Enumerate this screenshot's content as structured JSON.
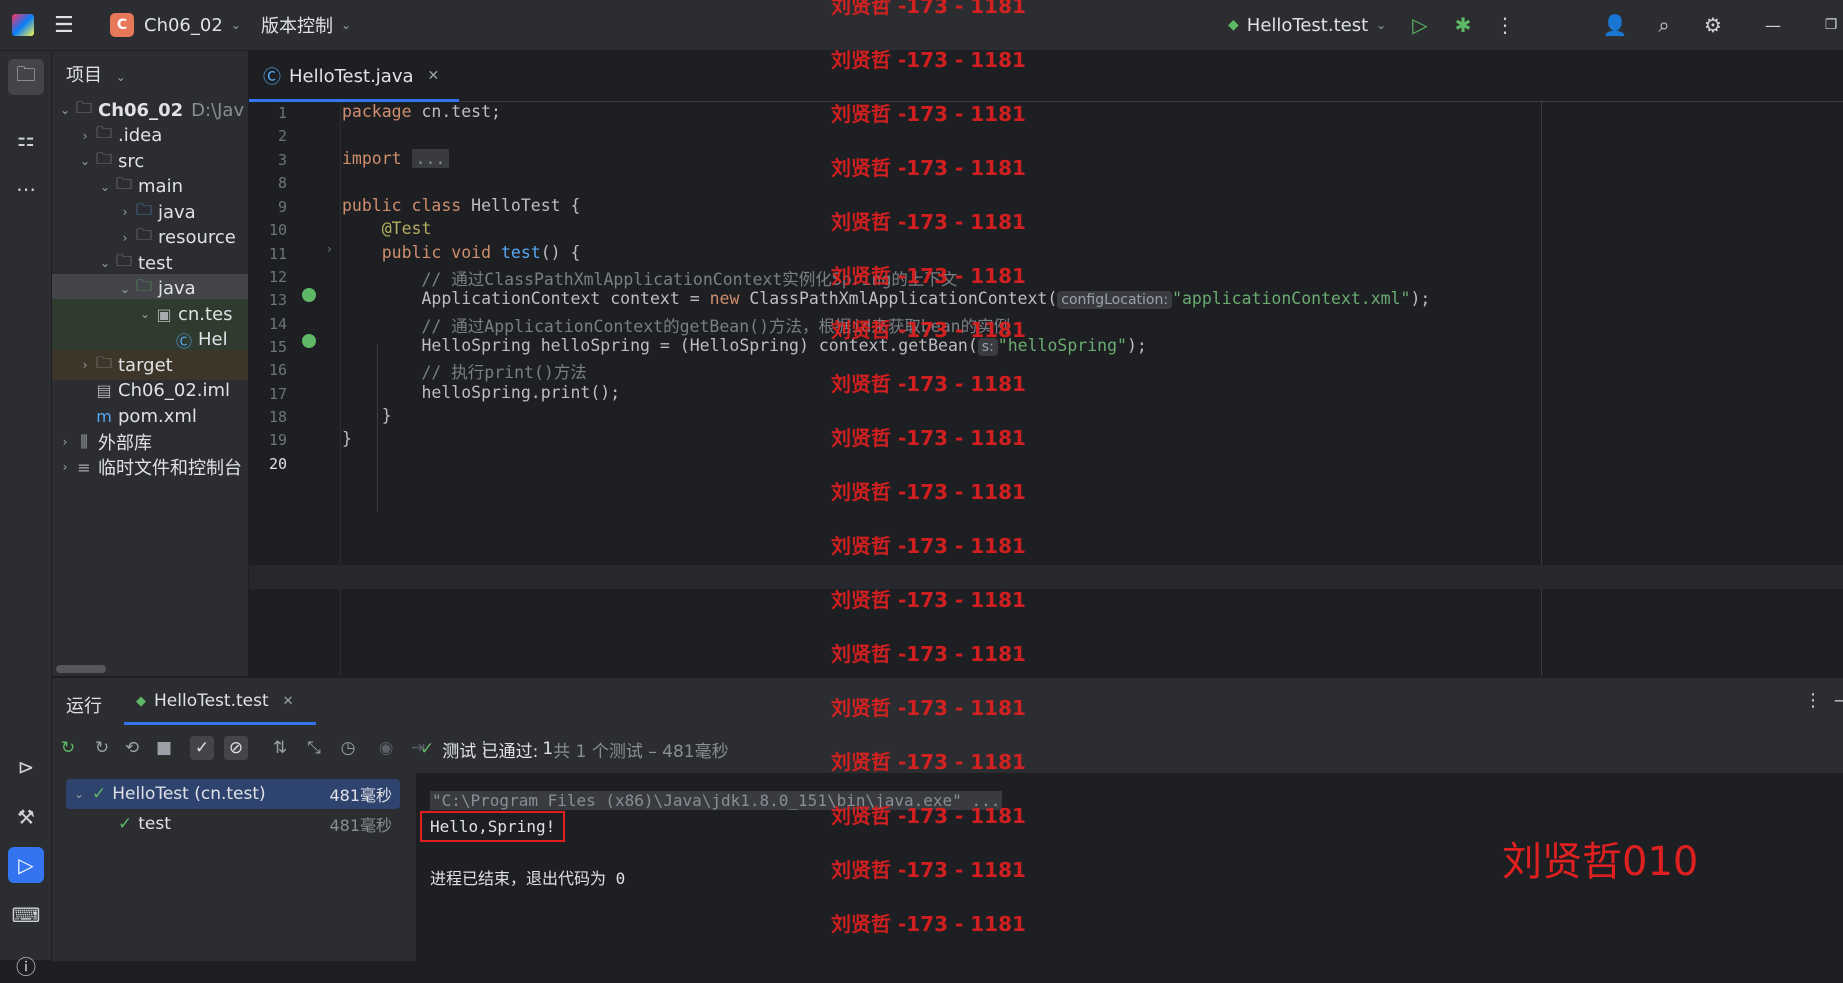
{
  "titlebar": {
    "project_initial": "C",
    "project_name": "Ch06_02",
    "vcs_label": "版本控制",
    "run_config": "HelloTest.test"
  },
  "project_panel": {
    "header": "项目",
    "tree": [
      {
        "label": "Ch06_02",
        "extra": "D:\\Jav",
        "indent": 0,
        "arrow": "open",
        "icon": "module-folder-icon",
        "bold": true
      },
      {
        "label": ".idea",
        "indent": 1,
        "arrow": "closed",
        "icon": "folder-icon"
      },
      {
        "label": "src",
        "indent": 1,
        "arrow": "open",
        "icon": "folder-icon"
      },
      {
        "label": "main",
        "indent": 2,
        "arrow": "open",
        "icon": "folder-icon"
      },
      {
        "label": "java",
        "indent": 3,
        "arrow": "closed",
        "icon": "source-folder-icon"
      },
      {
        "label": "resource",
        "indent": 3,
        "arrow": "closed",
        "icon": "resource-folder-icon"
      },
      {
        "label": "test",
        "indent": 2,
        "arrow": "open",
        "icon": "folder-icon"
      },
      {
        "label": "java",
        "indent": 3,
        "arrow": "open",
        "icon": "test-folder-icon",
        "state": "sel"
      },
      {
        "label": "cn.tes",
        "indent": 4,
        "arrow": "open",
        "icon": "package-icon",
        "state": "green"
      },
      {
        "label": "Hel",
        "indent": 5,
        "arrow": "none",
        "icon": "class-icon",
        "state": "green"
      },
      {
        "label": "target",
        "indent": 1,
        "arrow": "closed",
        "icon": "folder-icon",
        "state": "orange"
      },
      {
        "label": "Ch06_02.iml",
        "indent": 1,
        "arrow": "none",
        "icon": "file-icon"
      },
      {
        "label": "pom.xml",
        "indent": 1,
        "arrow": "none",
        "icon": "maven-icon"
      },
      {
        "label": "外部库",
        "indent": 0,
        "arrow": "closed",
        "icon": "library-icon"
      },
      {
        "label": "临时文件和控制台",
        "indent": 0,
        "arrow": "closed",
        "icon": "scratch-icon"
      }
    ]
  },
  "editor": {
    "tab_label": "HelloTest.java",
    "line_numbers": [
      "1",
      "2",
      "3",
      "8",
      "9",
      "10",
      "11",
      "12",
      "13",
      "14",
      "15",
      "16",
      "17",
      "18",
      "19",
      "20"
    ],
    "code": {
      "l1_kw": "package",
      "l1_rest": " cn.test;",
      "l3_kw": "import",
      "l3_fold": "...",
      "l9_kw": "public class",
      "l9_rest": " HelloTest {",
      "l10_an": "@Test",
      "l11_kw": "public void",
      "l11_fn": "test",
      "l11_rest": "() {",
      "l12_cm": "// 通过ClassPathXmlApplicationContext实例化Spring的上下文",
      "l13_a": "ApplicationContext context = ",
      "l13_kw": "new",
      "l13_b": " ClassPathXmlApplicationContext(",
      "l13_hint": "configLocation:",
      "l13_str": "\"applicationContext.xml\"",
      "l13_end": ");",
      "l14_cm": "// 通过ApplicationContext的getBean()方法，根据id来获取bean的实例",
      "l15_a": "HelloSpring helloSpring = (HelloSpring) context.getBean(",
      "l15_hint": "s:",
      "l15_str": "\"helloSpring\"",
      "l15_end": ");",
      "l16_cm": "// 执行print()方法",
      "l17": "helloSpring.print();",
      "l18": "}",
      "l19": "}"
    }
  },
  "run_panel": {
    "title": "运行",
    "tab_label": "HelloTest.test",
    "test_root": "HelloTest (cn.test)",
    "test_root_time": "481毫秒",
    "test_child": "test",
    "test_child_time": "481毫秒",
    "status_prefix": "测试 已通过:",
    "status_count": "1",
    "status_suffix": "共 1 个测试 – 481毫秒",
    "console_cmd": "\"C:\\Program Files (x86)\\Java\\jdk1.8.0_151\\bin\\java.exe\" ...",
    "console_output": "Hello,Spring!",
    "console_exit": "进程已结束，退出代码为 0"
  },
  "watermark": {
    "repeat_text": "刘贤哲 -173 - 1181",
    "big_text": "刘贤哲010"
  },
  "colors": {
    "accent": "#3574f0",
    "success": "#5fb865",
    "watermark": "#e02020",
    "badge": "#e8785a"
  }
}
